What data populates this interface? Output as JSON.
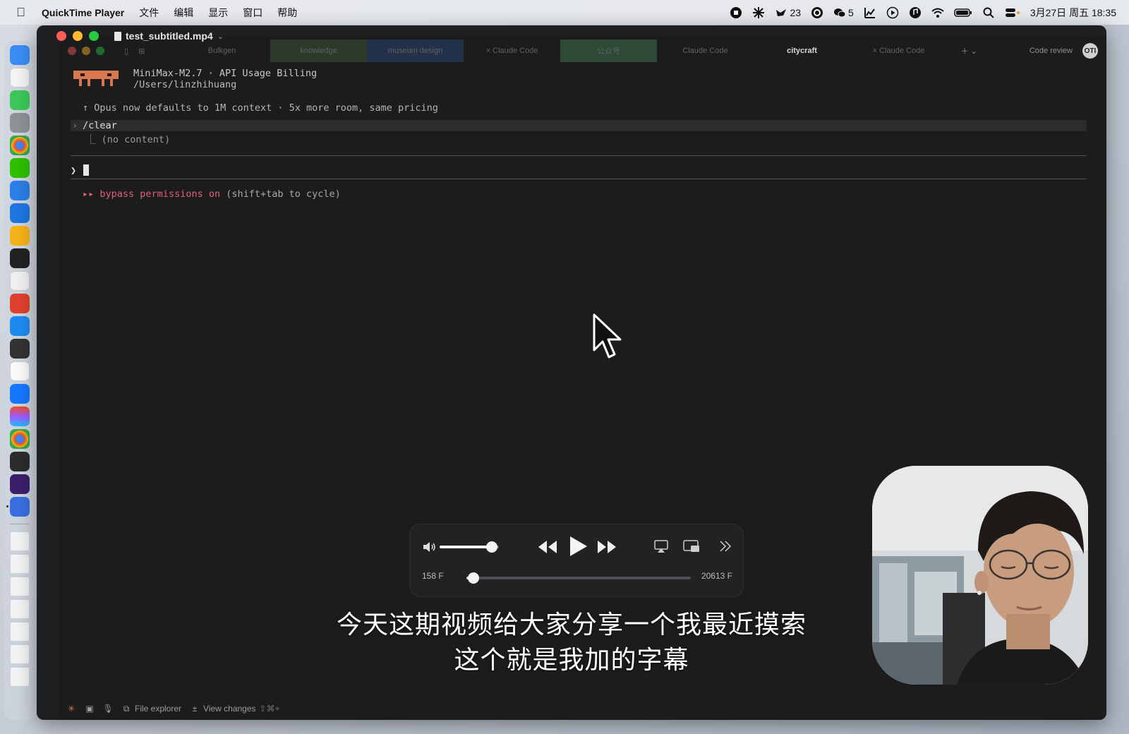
{
  "menubar": {
    "app_name": "QuickTime Player",
    "menus": [
      "文件",
      "编辑",
      "显示",
      "窗口",
      "帮助"
    ],
    "status": {
      "badge_1": "23",
      "badge_2": "5",
      "datetime": "3月27日 周五 18:35"
    }
  },
  "window": {
    "title": "test_subtitled.mp4"
  },
  "inner_app": {
    "tabs": [
      "Bulkgen",
      "knowledge",
      "museum design",
      "× Claude Code",
      "公众号",
      "Claude Code",
      "citycraft",
      "× Claude Code"
    ],
    "active_tab": "citycraft",
    "code_review_label": "Code review",
    "avatar_text": "OTI",
    "terminal": {
      "model_line": "MiniMax-M2.7 · API Usage Billing",
      "path_line": "/Users/linzhihuang",
      "notice_line": "↑ Opus now defaults to 1M context · 5x more room, same pricing",
      "command": "/clear",
      "command_output": "⎿  (no content)",
      "prompt_symbol": "❯",
      "mode_arrows": "▸▸",
      "mode_text": "bypass permissions on",
      "mode_hint": "(shift+tab to cycle)"
    },
    "bottom_bar": {
      "file_explorer_label": "File explorer",
      "view_changes_label": "View changes",
      "view_changes_shortcut": "⇧⌘+"
    }
  },
  "player": {
    "current_frame": "158 F",
    "total_frames": "20613 F",
    "progress_fraction": 0.0077,
    "volume_fraction": 0.88
  },
  "subtitles": {
    "line1": "今天这期视频给大家分享一个我最近摸索",
    "line2": "这个就是我加的字幕"
  },
  "colors": {
    "accent_bypass": "#e0607a",
    "terminal_bg": "#1c1c1d"
  }
}
